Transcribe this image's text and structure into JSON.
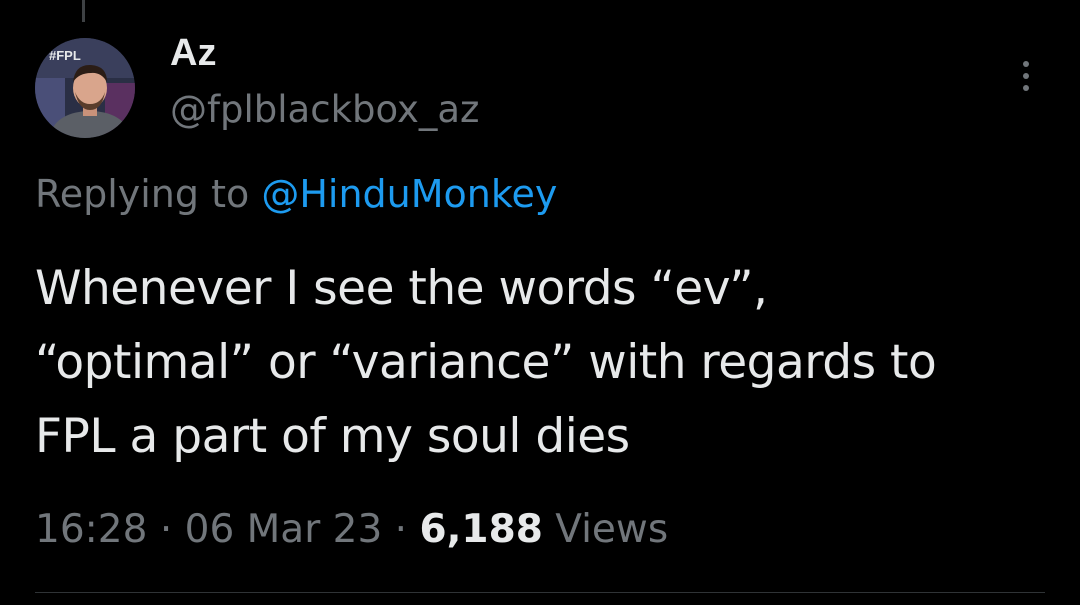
{
  "tweet": {
    "author": {
      "display_name": "Az",
      "handle": "@fplblackbox_az",
      "avatar_icon": "profile-photo",
      "avatar_badge_text": "#FPL"
    },
    "replying_prefix": "Replying to ",
    "replying_to": "@HinduMonkey",
    "text": "Whenever I see the words “ev”,\n“optimal” or “variance” with regards to\nFPL a part of my soul dies",
    "time": "16:28",
    "separator": "·",
    "date": "06 Mar 23",
    "views_count": "6,188",
    "views_label": "Views"
  },
  "colors": {
    "background": "#000000",
    "primary_text": "#e7e9ea",
    "secondary_text": "#71767b",
    "link": "#1d9bf0"
  },
  "icons": {
    "more": "more-vertical-icon"
  }
}
